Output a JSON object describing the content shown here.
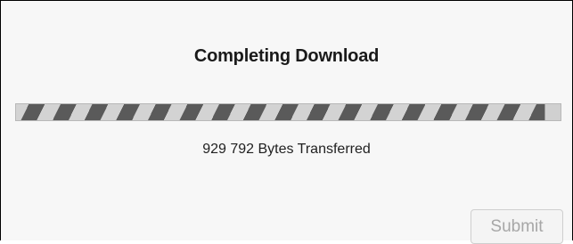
{
  "dialog": {
    "title": "Completing Download"
  },
  "progress": {
    "value": 0.97,
    "state": "indeterminate-striped",
    "stripe_color": "#5a5a5a",
    "track_color": "#d0d0d0"
  },
  "status": {
    "bytes_count": "929 792",
    "bytes_label": "Bytes Transferred"
  },
  "actions": {
    "submit_label": "Submit",
    "submit_enabled": false
  }
}
